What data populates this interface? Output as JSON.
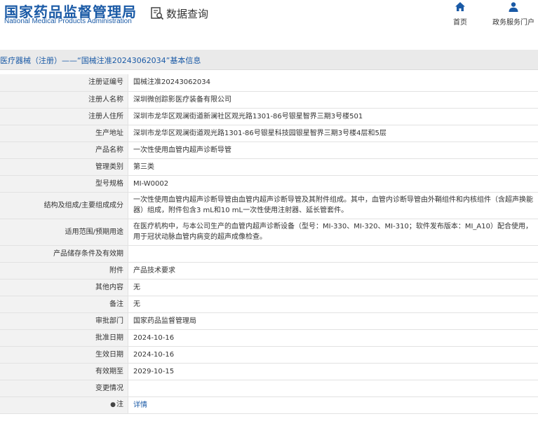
{
  "header": {
    "logo_cn": "国家药品监督管理局",
    "logo_en": "National Medical Products Administration",
    "query_label": "数据查询",
    "nav": [
      {
        "label": "首页",
        "icon": "home-icon"
      },
      {
        "label": "政务服务门户",
        "icon": "user-icon"
      }
    ]
  },
  "breadcrumb": "医疗器械（注册）——“国械注准20243062034”基本信息",
  "rows": [
    {
      "label": "注册证编号",
      "value": "国械注准20243062034"
    },
    {
      "label": "注册人名称",
      "value": "深圳微创踪影医疗装备有限公司"
    },
    {
      "label": "注册人住所",
      "value": "深圳市龙华区观澜街道新澜社区观光路1301-86号银星智界三期3号楼501"
    },
    {
      "label": "生产地址",
      "value": "深圳市龙华区观澜街道观光路1301-86号银星科技园银星智界三期3号楼4层和5层"
    },
    {
      "label": "产品名称",
      "value": "一次性使用血管内超声诊断导管"
    },
    {
      "label": "管理类别",
      "value": "第三类"
    },
    {
      "label": "型号规格",
      "value": "MI-W0002"
    },
    {
      "label": "结构及组成/主要组成成分",
      "value": "一次性使用血管内超声诊断导管由血管内超声诊断导管及其附件组成。其中，血管内诊断导管由外鞘组件和内核组件（含超声换能器）组成，附件包含3 mL和10 mL一次性使用注射器、延长管套件。"
    },
    {
      "label": "适用范围/预期用途",
      "value": "在医疗机构中，与本公司生产的血管内超声诊断设备（型号：MI-330、MI-320、MI-310；软件发布版本：MI_A10）配合使用，用于冠状动脉血管内病变的超声成像检查。"
    },
    {
      "label": "产品储存条件及有效期",
      "value": ""
    },
    {
      "label": "附件",
      "value": "产品技术要求"
    },
    {
      "label": "其他内容",
      "value": "无"
    },
    {
      "label": "备注",
      "value": "无"
    },
    {
      "label": "审批部门",
      "value": "国家药品监督管理局"
    },
    {
      "label": "批准日期",
      "value": "2024-10-16"
    },
    {
      "label": "生效日期",
      "value": "2024-10-16"
    },
    {
      "label": "有效期至",
      "value": "2029-10-15"
    },
    {
      "label": "变更情况",
      "value": ""
    }
  ],
  "note_row": {
    "pin": "●",
    "label": "注",
    "link_text": "详情"
  },
  "colors": {
    "brand": "#1a5aa6",
    "label_bg": "#f2f2f2",
    "titlebar_bg": "#eaeaea"
  }
}
